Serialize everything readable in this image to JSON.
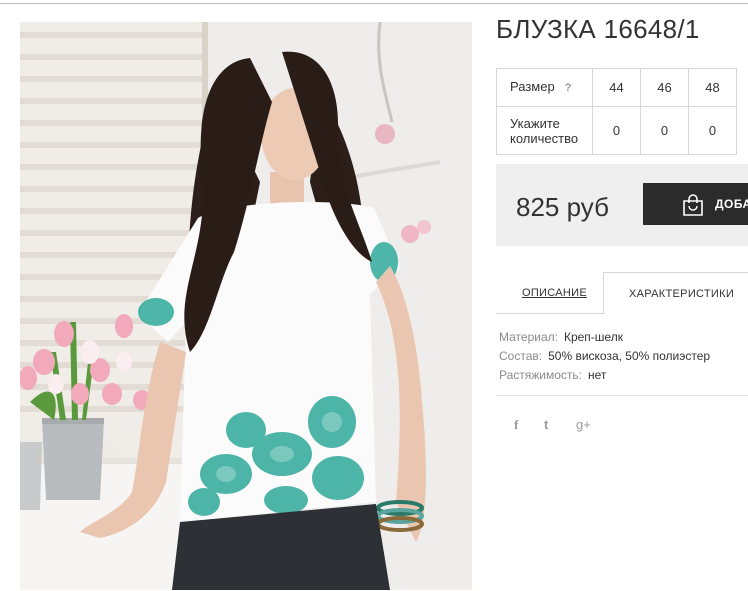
{
  "product": {
    "title": "БЛУЗКА 16648/1",
    "photo_alt": "фото товара"
  },
  "sizes": {
    "size_label": "Размер",
    "help_mark": "?",
    "qty_label": "Укажите количество",
    "values": [
      "44",
      "46",
      "48"
    ],
    "quantities": [
      "0",
      "0",
      "0"
    ]
  },
  "purchase": {
    "price": "825 руб",
    "cart_label": "ДОБАВИТЬ В КОРЗИНУ"
  },
  "tabs": {
    "description": "ОПИСАНИЕ",
    "characteristics": "ХАРАКТЕРИСТИКИ"
  },
  "characteristics": [
    {
      "key": "Материал:",
      "value": "Креп-шелк"
    },
    {
      "key": "Состав:",
      "value": "50% вискоза, 50% полиэстер"
    },
    {
      "key": "Растяжимость:",
      "value": "нет"
    }
  ],
  "social": {
    "facebook": "f",
    "twitter": "t",
    "google": "g+",
    "icons": [
      "facebook-icon",
      "twitter-icon",
      "google-plus-icon"
    ]
  },
  "colors": {
    "button_bg": "#2b2b2b",
    "price_box_bg": "#efefef",
    "print_teal": "#2fa89a"
  }
}
